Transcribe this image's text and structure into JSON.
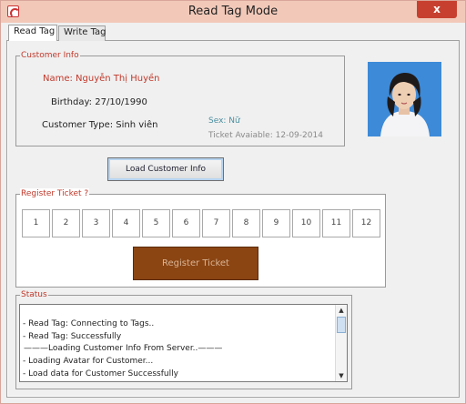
{
  "window": {
    "title": "Read Tag Mode",
    "close_label": "x"
  },
  "tabs": [
    {
      "label": "Read Tag"
    },
    {
      "label": "Write Tag"
    }
  ],
  "customer_info": {
    "legend": "Customer Info",
    "name": "Name: Nguyễn Thị Huyền",
    "birthday": "Birthday: 27/10/1990",
    "customer_type": "Customer Type: Sinh viên",
    "sex": "Sex: Nữ",
    "ticket_available": "Ticket Avaiable: 12-09-2014"
  },
  "load_button_label": "Load Customer Info",
  "register": {
    "legend": "Register Ticket ?",
    "tickets": [
      "1",
      "2",
      "3",
      "4",
      "5",
      "6",
      "7",
      "8",
      "9",
      "10",
      "11",
      "12"
    ],
    "button_label": "Register Ticket"
  },
  "status": {
    "legend": "Status",
    "log": [
      "- Read Tag: Connecting to Tags..",
      "- Read Tag: Successfully",
      "———Loading Customer Info From Server..———",
      "- Loading Avatar for Customer...",
      "- Load data for Customer Successfully"
    ]
  },
  "colors": {
    "title_bar": "#f2c9b9",
    "close_button": "#c7402f",
    "name_text": "#c0392b",
    "sex_text": "#4a8fa0",
    "register_button": "#8b4513"
  },
  "icons": {
    "app": "app-logo-icon",
    "scroll_up": "scroll-up-icon",
    "scroll_down": "scroll-down-icon"
  }
}
